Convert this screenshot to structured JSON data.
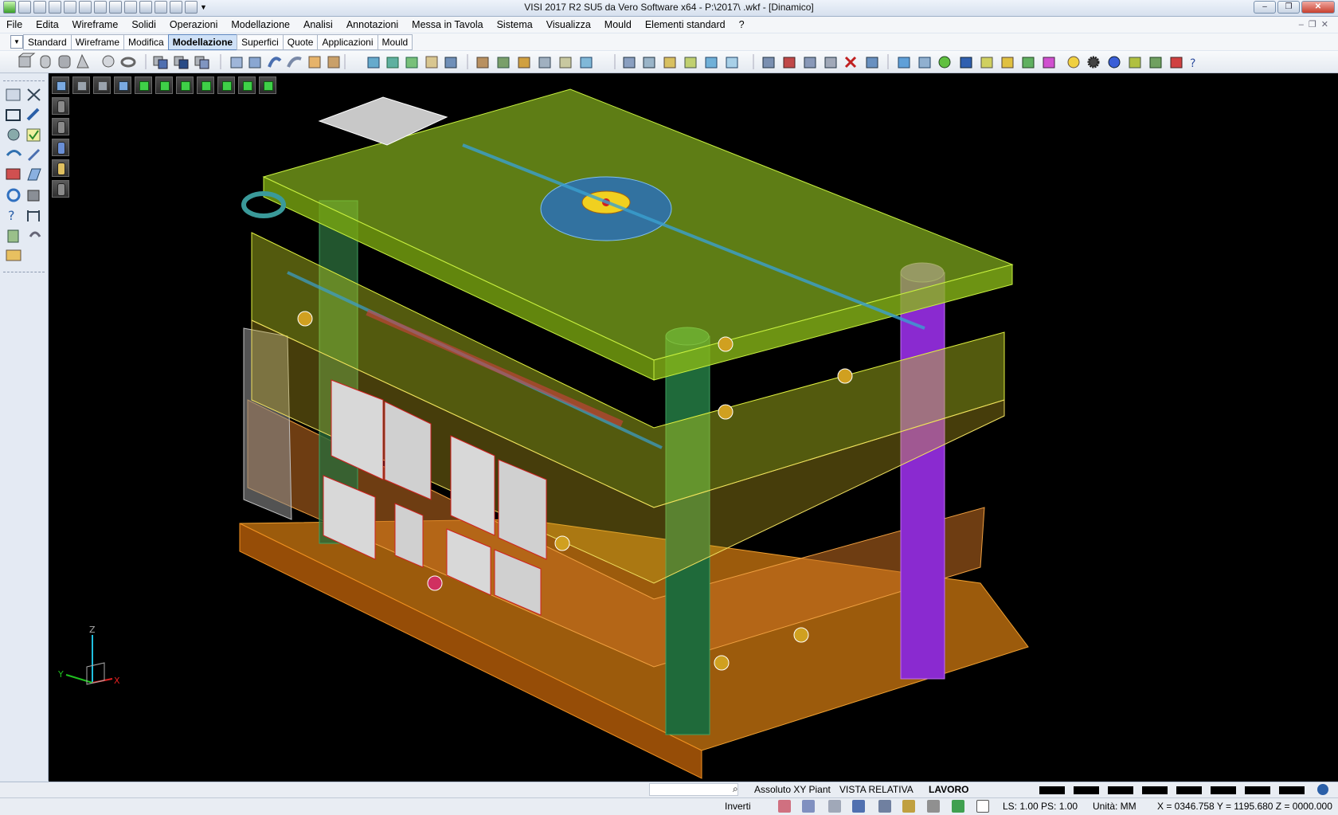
{
  "window": {
    "title": "VISI 2017 R2 SU5 da Vero Software x64 - P:\\2017\\                                         .wkf - [Dinamico]",
    "controls": [
      "–",
      "❐",
      "✕"
    ]
  },
  "menu": [
    "File",
    "Edita",
    "Wireframe",
    "Solidi",
    "Operazioni",
    "Modellazione",
    "Analisi",
    "Annotazioni",
    "Messa in Tavola",
    "Sistema",
    "Visualizza",
    "Mould",
    "Elementi standard",
    "?"
  ],
  "tabs": {
    "items": [
      "Standard",
      "Wireframe",
      "Modifica",
      "Modellazione",
      "Superfici",
      "Quote",
      "Applicazioni",
      "Mould"
    ],
    "active": "Modellazione"
  },
  "axis_triad": {
    "x": "X",
    "y": "Y",
    "z": "Z"
  },
  "status": {
    "search_placeholder": "",
    "coord_mode": "Assoluto XY Piant",
    "view_mode": "VISTA RELATIVA",
    "workspace": "LAVORO",
    "invert": "Inverti",
    "ls_ps": "LS: 1.00 PS: 1.00",
    "units": "Unità: MM",
    "coords": "X = 0346.758 Y = 1195.680 Z = 0000.000"
  }
}
